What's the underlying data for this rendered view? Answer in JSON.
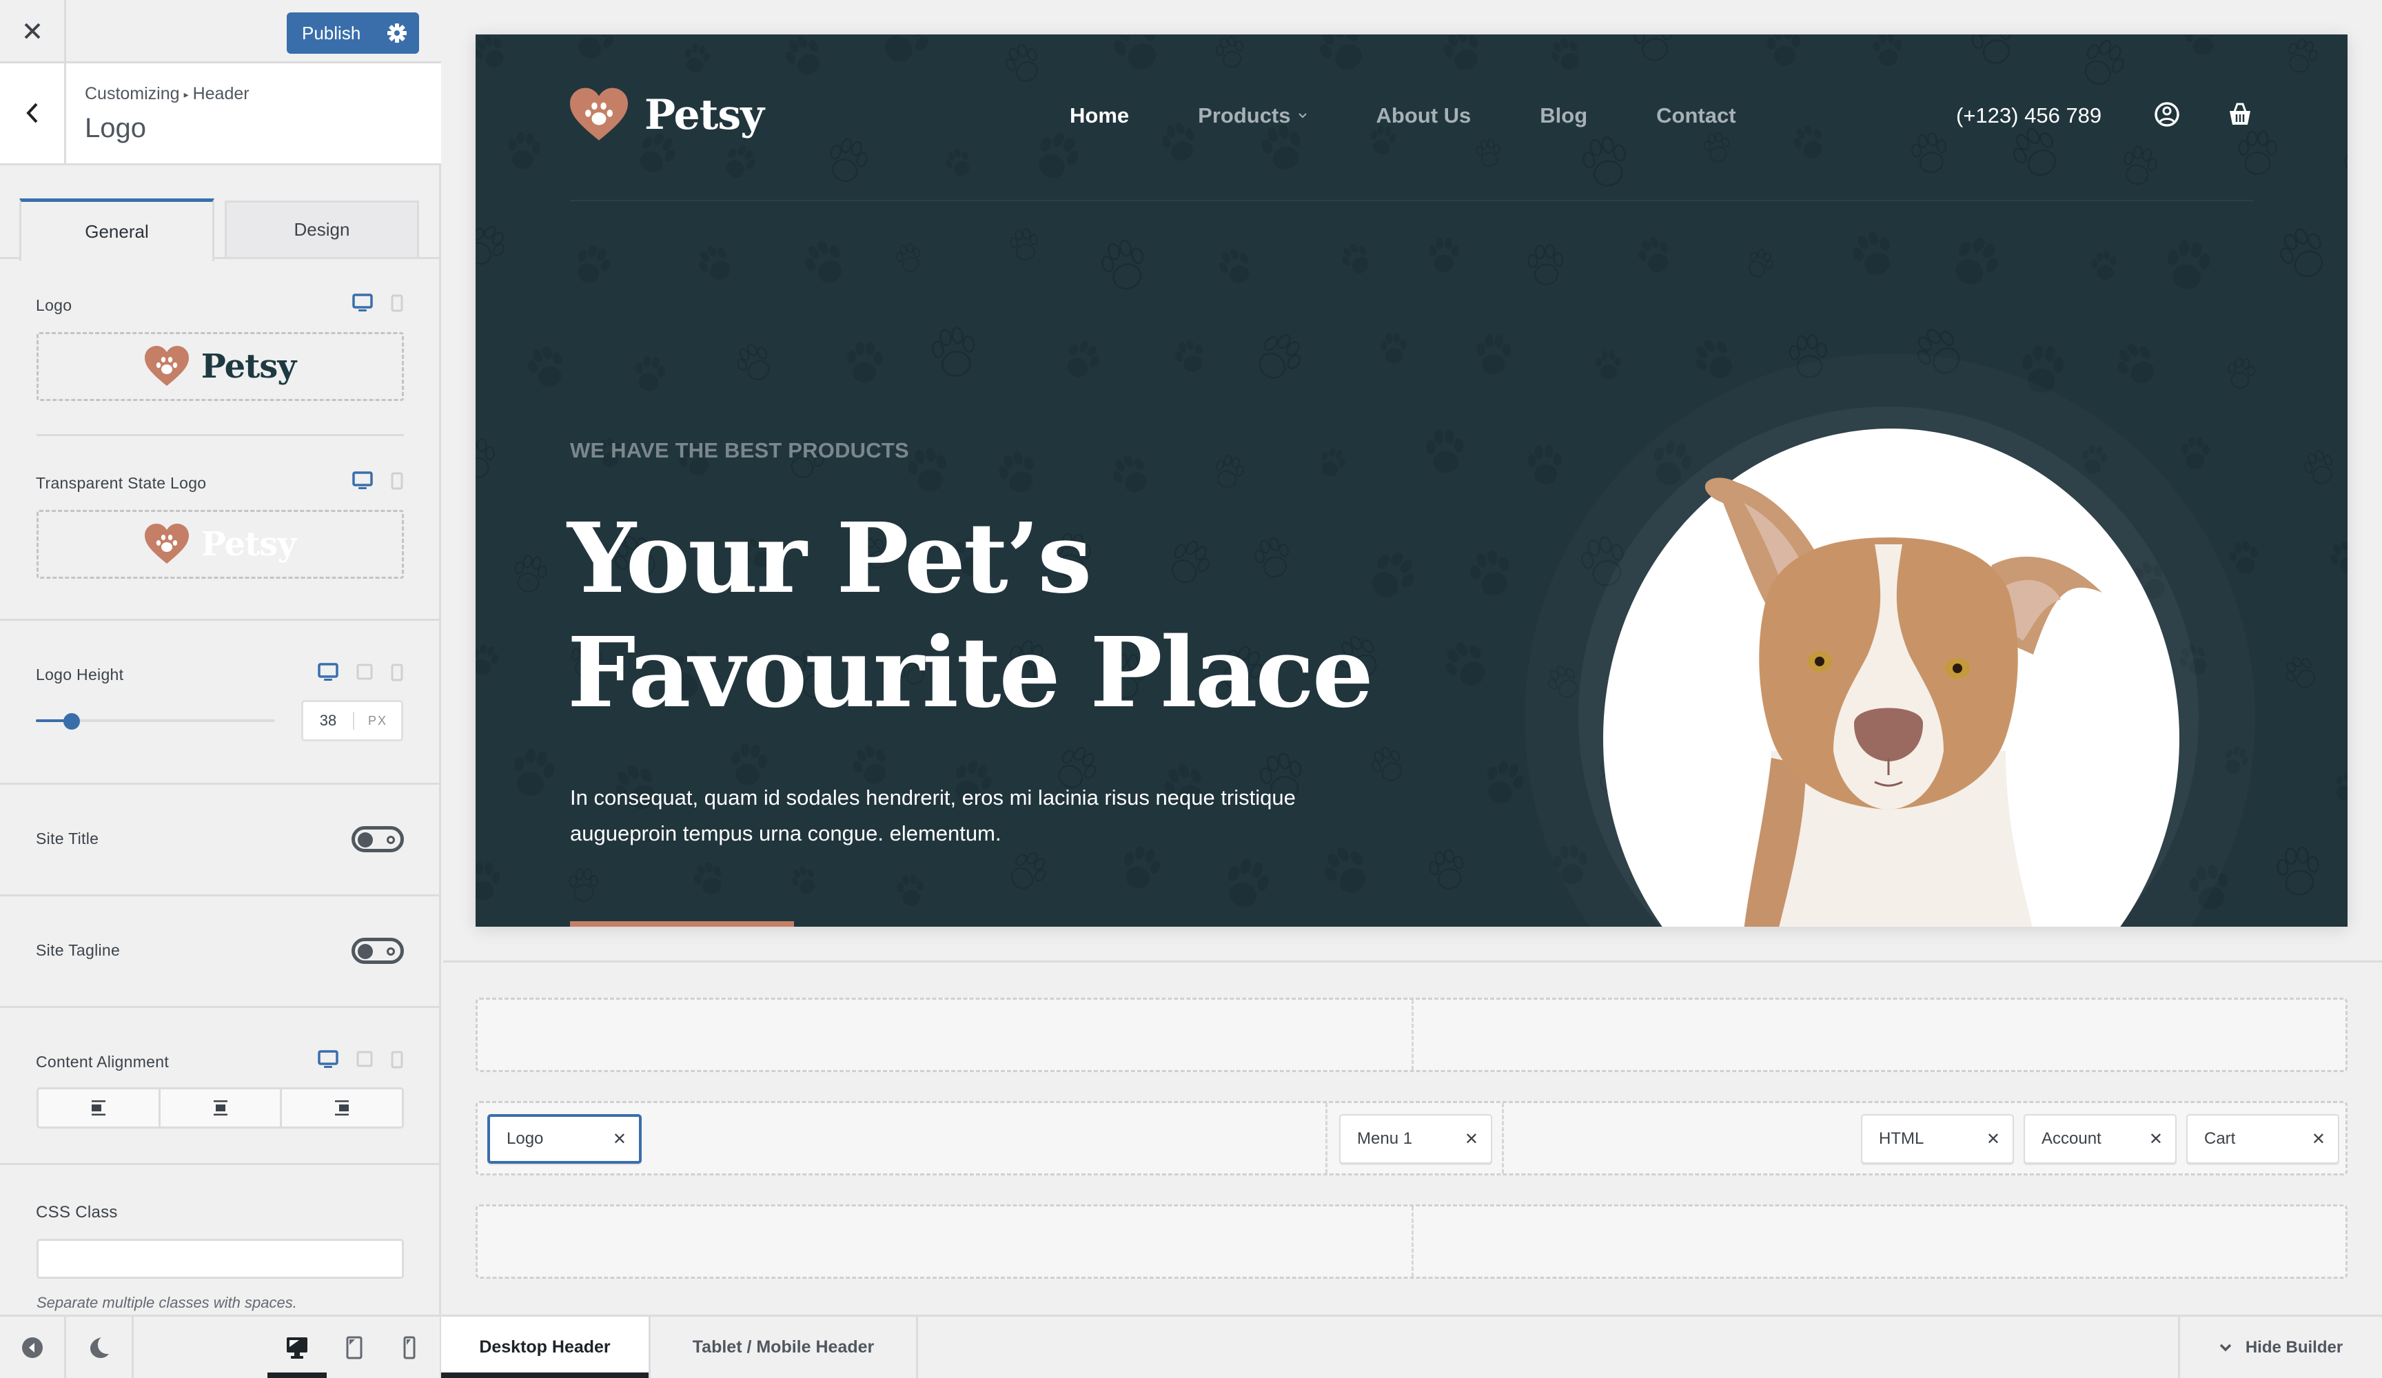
{
  "topbar": {
    "close_label": "✕",
    "publish_label": "Publish"
  },
  "section": {
    "breadcrumb_root": "Customizing",
    "breadcrumb_sep": "▸",
    "breadcrumb_parent": "Header",
    "title": "Logo"
  },
  "tabs": [
    {
      "label": "General",
      "active": true
    },
    {
      "label": "Design",
      "active": false
    }
  ],
  "controls": {
    "logo": {
      "label": "Logo",
      "brand": "Petsy"
    },
    "transparent_logo": {
      "label": "Transparent State Logo",
      "brand": "Petsy"
    },
    "logo_height": {
      "label": "Logo Height",
      "value": "38",
      "unit": "PX",
      "slider_fraction": 0.15
    },
    "site_title": {
      "label": "Site Title",
      "enabled": false
    },
    "site_tagline": {
      "label": "Site Tagline",
      "enabled": false
    },
    "content_alignment": {
      "label": "Content Alignment",
      "options": [
        "left",
        "center",
        "right"
      ]
    },
    "css_class": {
      "label": "CSS Class",
      "value": "",
      "help": "Separate multiple classes with spaces."
    }
  },
  "footer": {
    "tabs": [
      {
        "label": "Desktop Header",
        "active": true
      },
      {
        "label": "Tablet / Mobile Header",
        "active": false
      }
    ],
    "hide_builder_label": "Hide Builder"
  },
  "preview": {
    "brand": "Petsy",
    "nav": [
      {
        "label": "Home",
        "active": true,
        "has_dropdown": false
      },
      {
        "label": "Products",
        "active": false,
        "has_dropdown": true
      },
      {
        "label": "About Us",
        "active": false,
        "has_dropdown": false
      },
      {
        "label": "Blog",
        "active": false,
        "has_dropdown": false
      },
      {
        "label": "Contact",
        "active": false,
        "has_dropdown": false
      }
    ],
    "phone": "(+123) 456 789",
    "eyebrow": "WE HAVE THE BEST PRODUCTS",
    "hero_title_line1": "Your Pet’s",
    "hero_title_line2": "Favourite Place",
    "hero_text": "In consequat, quam id sodales hendrerit, eros mi lacinia risus neque tristique augueproin tempus urna congue. elementum."
  },
  "builder": {
    "main_row": {
      "left": [
        {
          "label": "Logo",
          "selected": true
        }
      ],
      "center": [
        {
          "label": "Menu 1",
          "selected": false
        }
      ],
      "right": [
        {
          "label": "HTML",
          "selected": false
        },
        {
          "label": "Account",
          "selected": false
        },
        {
          "label": "Cart",
          "selected": false
        }
      ]
    },
    "remove_glyph": "✕"
  },
  "colors": {
    "accent": "#3a6eab",
    "hero_bg": "#21353d",
    "brand_terracotta": "#c47f66"
  }
}
